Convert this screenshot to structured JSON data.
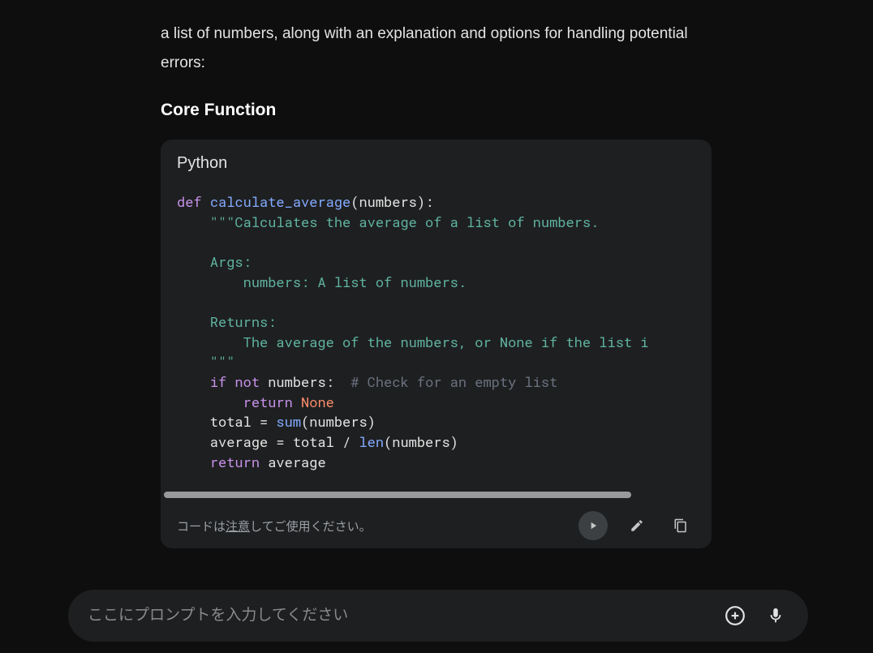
{
  "intro": "a list of numbers, along with an explanation and options for handling potential errors:",
  "heading": "Core Function",
  "code": {
    "language": "Python",
    "line1_def": "def",
    "line1_fn": "calculate_average",
    "line1_rest": "(numbers):",
    "line2_doc": "    \"\"\"Calculates the average of a list of numbers.",
    "line3_blank": "",
    "line4_doc": "    Args:",
    "line5_doc": "        numbers: A list of numbers.",
    "line6_blank": "",
    "line7_doc": "    Returns:",
    "line8_doc": "        The average of the numbers, or None if the list i",
    "line9_doc": "    \"\"\"",
    "line10_if": "if",
    "line10_not": "not",
    "line10_rest": " numbers:  ",
    "line10_com": "# Check for an empty list",
    "line11_ret": "return",
    "line11_none": "None",
    "line12_a": "    total = ",
    "line12_sum": "sum",
    "line12_b": "(numbers)",
    "line13_a": "    average = total / ",
    "line13_len": "len",
    "line13_b": "(numbers)",
    "line14_ret": "return",
    "line14_rest": " average"
  },
  "footer": {
    "prefix": "コードは",
    "link": "注意",
    "suffix": "してご使用ください。"
  },
  "input": {
    "placeholder": "ここにプロンプトを入力してください"
  }
}
